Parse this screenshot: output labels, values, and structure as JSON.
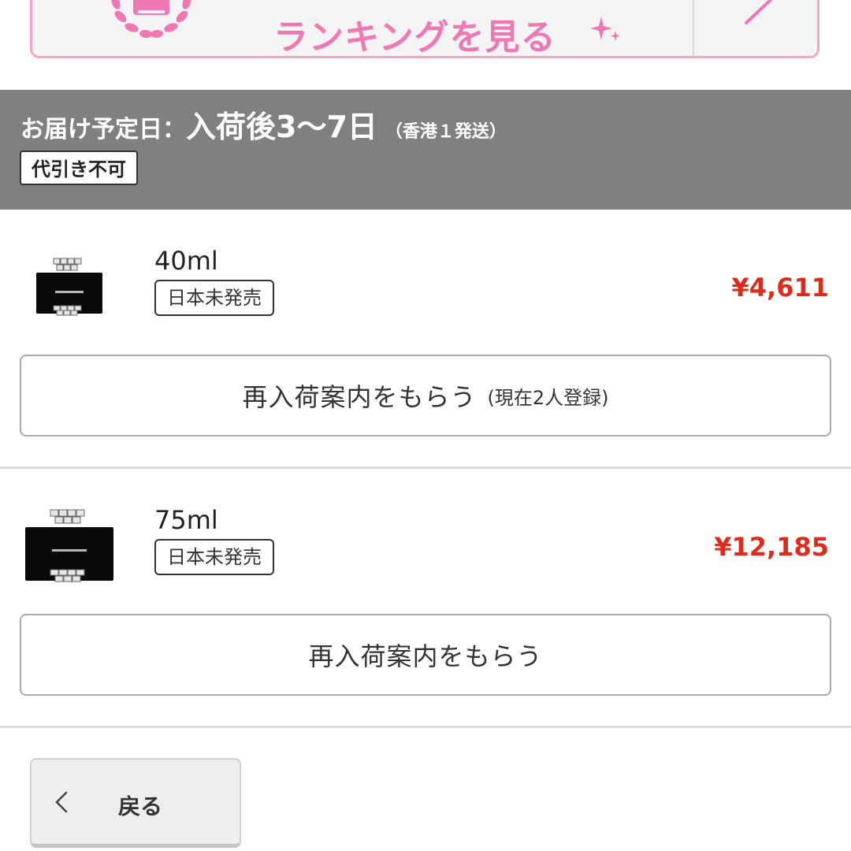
{
  "ranking_banner": {
    "label": "ランキングを見る",
    "accent_color": "#ee78b2",
    "border_color": "#f1a6c8",
    "emblem_icon": "crown-laurel-icon",
    "sparkle_icon": "sparkle-icon",
    "arrow_icon": "chevron-right-icon"
  },
  "delivery": {
    "label": "お届け予定日",
    "colon": "：",
    "value": "入荷後3〜7日",
    "note": "（香港１発送）",
    "cod_badge": "代引き不可",
    "bar_color": "#808080"
  },
  "variants": [
    {
      "size": "40ml",
      "badge": "日本未発売",
      "price": "¥4,611",
      "restock_label": "再入荷案内をもらう",
      "restock_count": "(現在2人登録)",
      "thumb_icon": "perfume-bottle-icon"
    },
    {
      "size": "75ml",
      "badge": "日本未発売",
      "price": "¥12,185",
      "restock_label": "再入荷案内をもらう",
      "thumb_icon": "perfume-bottle-icon"
    }
  ],
  "back_button": {
    "label": "戻る",
    "icon": "chevron-left-icon"
  },
  "price_color": "#e02a1c"
}
